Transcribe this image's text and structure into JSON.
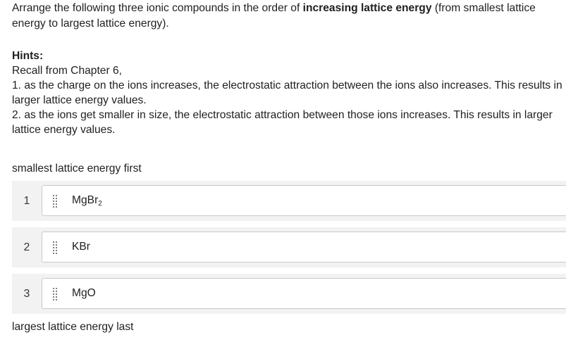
{
  "question": {
    "prefix": "Arrange the following three ionic compounds in the order of ",
    "emphasis": "increasing lattice energy",
    "suffix": " (from smallest lattice energy to largest lattice energy)."
  },
  "hints": {
    "title": "Hints:",
    "intro": "Recall from Chapter 6,",
    "items": [
      "1. as the charge on the ions increases, the electrostatic attraction between the ions also increases. This results in larger lattice energy values.",
      "2. as the ions get smaller in size, the electrostatic attraction between those ions increases. This results in larger lattice energy values."
    ]
  },
  "ranking": {
    "top_label": "smallest lattice energy first",
    "bottom_label": "largest lattice energy last",
    "items": [
      {
        "rank": "1",
        "formula": "MgBr",
        "subscript": "2"
      },
      {
        "rank": "2",
        "formula": "KBr",
        "subscript": ""
      },
      {
        "rank": "3",
        "formula": "MgO",
        "subscript": ""
      }
    ]
  },
  "icons": {
    "drag_handle": "drag-handle-icon"
  },
  "colors": {
    "row_background": "#f2f2f2",
    "card_border": "#c9c9c9",
    "text": "#1f1f1f"
  }
}
